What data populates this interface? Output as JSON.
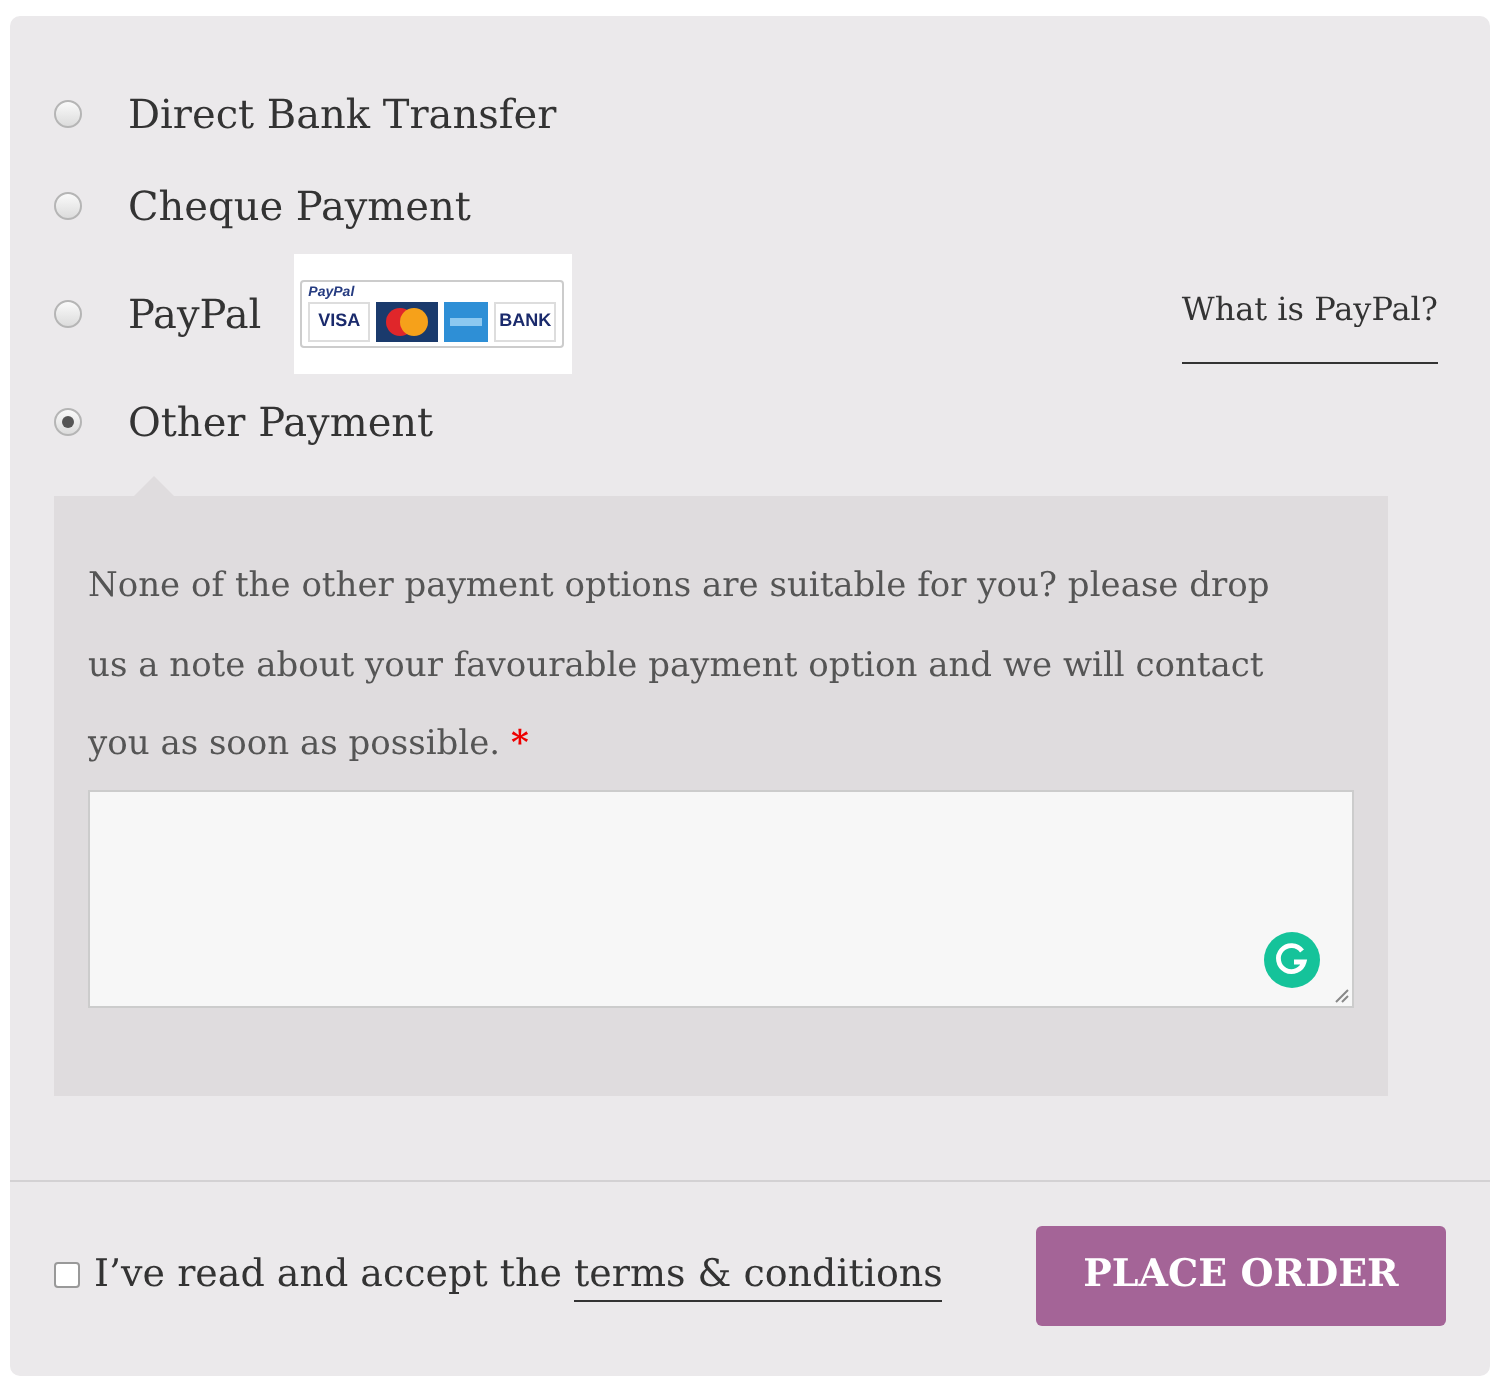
{
  "payment_methods": [
    {
      "label": "Direct Bank Transfer",
      "selected": false
    },
    {
      "label": "Cheque Payment",
      "selected": false
    },
    {
      "label": "PayPal",
      "selected": false,
      "badge": {
        "brand": "PayPal",
        "cards": [
          {
            "kind": "text",
            "label": "VISA"
          },
          {
            "kind": "mastercard"
          },
          {
            "kind": "amex"
          },
          {
            "kind": "text",
            "label": "BANK"
          }
        ]
      },
      "link": "What is PayPal?"
    },
    {
      "label": "Other Payment",
      "selected": true,
      "description": "None of the other payment options are suitable for you? please drop us a note about your favourable payment option and we will contact you as soon as possible.",
      "required_mark": "*"
    }
  ],
  "terms": {
    "checked": false,
    "text": "I’ve read and accept the",
    "link": "terms & conditions"
  },
  "place_order": "PLACE ORDER"
}
